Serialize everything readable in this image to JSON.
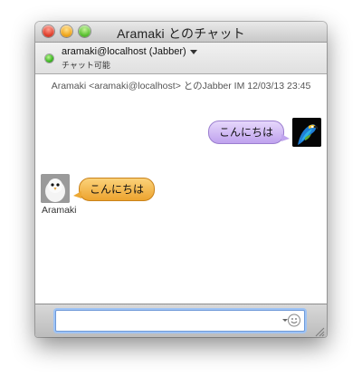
{
  "window": {
    "title": "Aramaki とのチャット"
  },
  "account": {
    "name": "aramaki@localhost (Jabber)",
    "status": "チャット可能",
    "status_color": "#3bb522"
  },
  "chat": {
    "session_info": "Aramaki <aramaki@localhost> とのJabber IM   12/03/13 23:45",
    "messages": [
      {
        "from": "me",
        "text": "こんにちは",
        "bubble_color": "#c9b0f2",
        "avatar": "parrot-avatar"
      },
      {
        "from": "Aramaki",
        "text": "こんにちは",
        "bubble_color": "#f3b64a",
        "avatar": "bird-avatar",
        "sender_label": "Aramaki"
      }
    ]
  },
  "input": {
    "value": "",
    "placeholder": ""
  },
  "icons": {
    "emoticon": "smiley-icon",
    "resize": "resize-grip-icon"
  }
}
